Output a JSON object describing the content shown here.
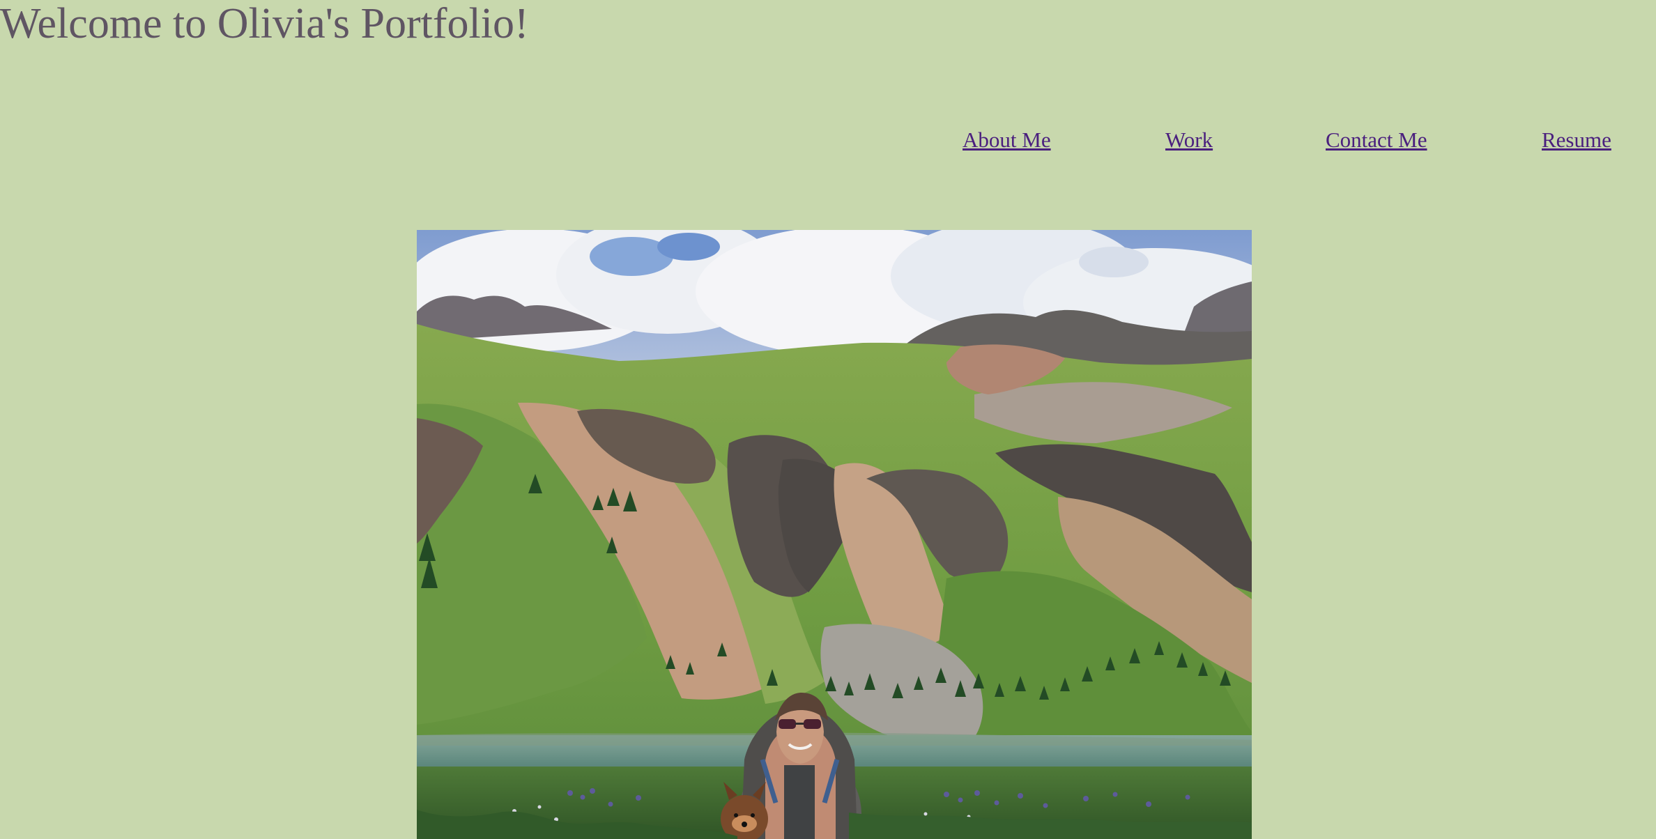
{
  "header": {
    "title": "Welcome to Olivia's Portfolio!"
  },
  "nav": {
    "items": [
      {
        "label": "About Me"
      },
      {
        "label": "Work"
      },
      {
        "label": "Contact Me"
      },
      {
        "label": "Resume"
      }
    ]
  },
  "hero": {
    "image_subject": "portrait photo at an alpine lake with mountains and a dog",
    "icon": "photo-image"
  },
  "colors": {
    "background": "#c8d8ad",
    "title": "#5f5563",
    "link": "#4a1f7e"
  }
}
